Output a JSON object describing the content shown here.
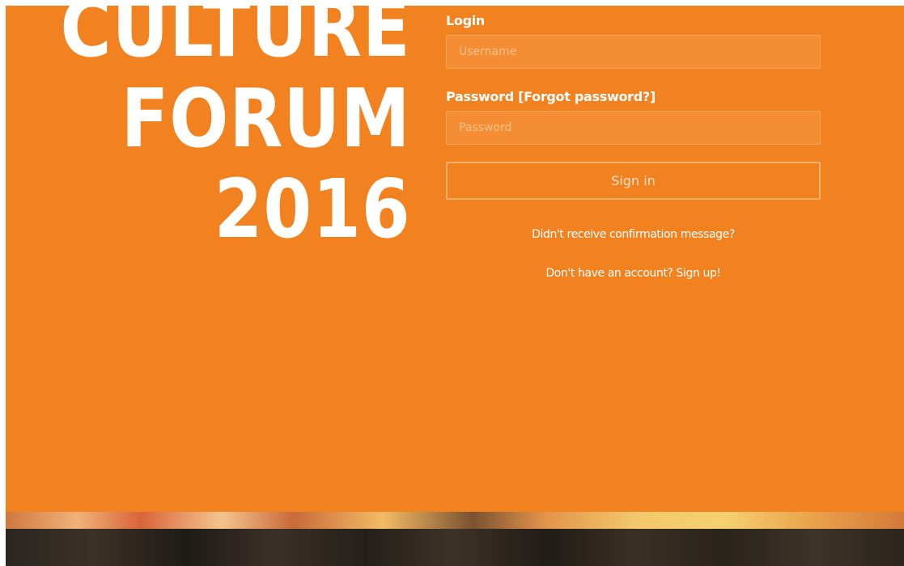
{
  "hero": {
    "line1": "CULTURE",
    "line2": "FORUM",
    "line3": "2016"
  },
  "login_form": {
    "login_label": "Login",
    "username_placeholder": "Username",
    "password_label": "Password [Forgot password?]",
    "password_placeholder": "Password",
    "signin_label": "Sign in",
    "confirmation_link": "Didn't receive confirmation message?",
    "signup_link": "Don't have an account? Sign up!"
  },
  "colors": {
    "brand_orange": "#f28220",
    "text_white": "#ffffff"
  }
}
